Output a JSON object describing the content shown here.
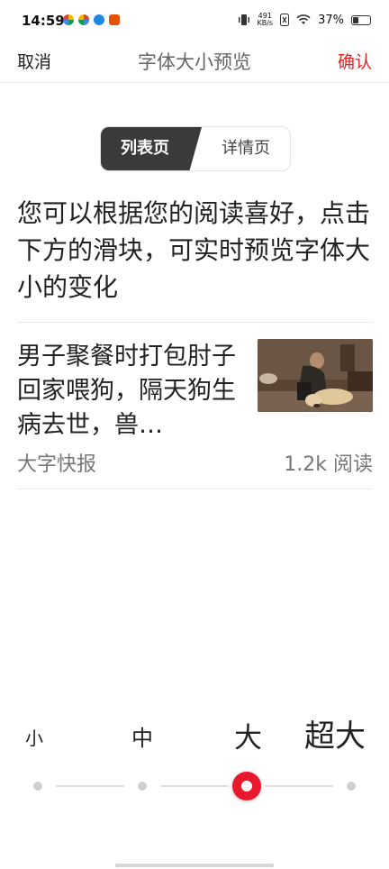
{
  "status": {
    "time": "14:59",
    "net_speed_value": "491",
    "net_speed_unit": "KB/s",
    "battery": "37%",
    "battery_level": 0.37
  },
  "header": {
    "cancel": "取消",
    "title": "字体大小预览",
    "confirm": "确认",
    "confirm_color": "#e62222"
  },
  "tabs": {
    "list": "列表页",
    "detail": "详情页",
    "active": "list"
  },
  "intro_text": "您可以根据您的阅读喜好，点击下方的滑块，可实时预览字体大小的变化",
  "news": {
    "title": "男子聚餐时打包肘子回家喂狗，隔天狗生病去世，兽…",
    "source": "大字快报",
    "reads": "1.2k 阅读"
  },
  "font_sizes": {
    "small": "小",
    "medium": "中",
    "large": "大",
    "xlarge": "超大",
    "selected_index": 2,
    "count": 4
  },
  "colors": {
    "accent": "#e8192c"
  }
}
